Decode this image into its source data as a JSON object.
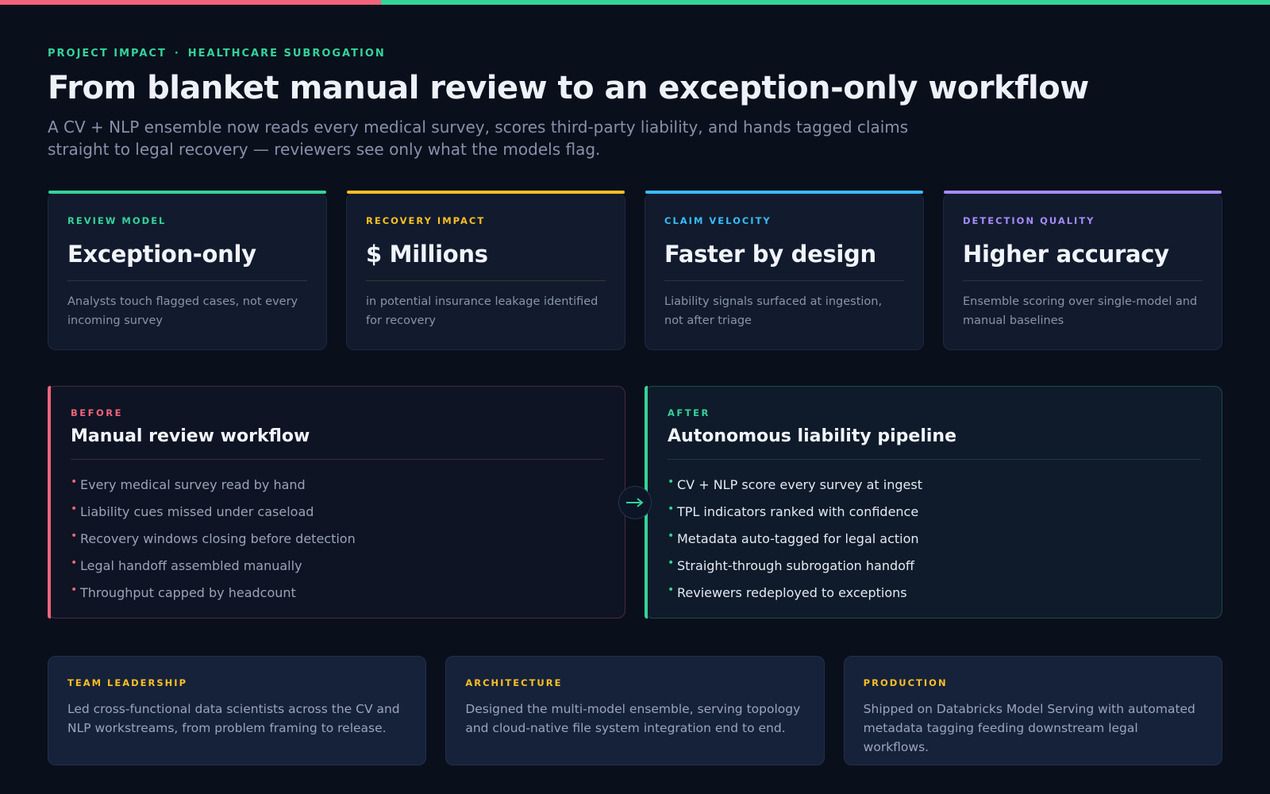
{
  "colors": {
    "background": "#0a0f1c",
    "green": "#34d399",
    "pink": "#f0647c",
    "yellow": "#fbbf24",
    "blue": "#38bdf8",
    "purple": "#a78bfa"
  },
  "header": {
    "eyebrow_left": "PROJECT IMPACT",
    "eyebrow_sep": "·",
    "eyebrow_right": "HEALTHCARE SUBROGATION",
    "title": "From blanket manual review to an exception-only workflow",
    "subtitle": "A CV + NLP ensemble now reads every medical survey, scores third-party liability, and hands tagged claims straight to legal recovery — reviewers see only what the models flag."
  },
  "kpis": [
    {
      "label": "REVIEW MODEL",
      "value": "Exception-only",
      "desc": "Analysts touch flagged cases, not every incoming survey",
      "color": "#34d399"
    },
    {
      "label": "RECOVERY IMPACT",
      "value": "$ Millions",
      "desc": "in potential insurance leakage identified for recovery",
      "color": "#fbbf24"
    },
    {
      "label": "CLAIM VELOCITY",
      "value": "Faster by design",
      "desc": "Liability signals surfaced at ingestion, not after triage",
      "color": "#38bdf8"
    },
    {
      "label": "DETECTION QUALITY",
      "value": "Higher accuracy",
      "desc": "Ensemble scoring over single-model and manual baselines",
      "color": "#a78bfa"
    }
  ],
  "before": {
    "label": "BEFORE",
    "title": "Manual review workflow",
    "items": [
      "Every medical survey read by hand",
      "Liability cues missed under caseload",
      "Recovery windows closing before detection",
      "Legal handoff assembled manually",
      "Throughput capped by headcount"
    ]
  },
  "after": {
    "label": "AFTER",
    "title": "Autonomous liability pipeline",
    "items": [
      "CV + NLP score every survey at ingest",
      "TPL indicators ranked with confidence",
      "Metadata auto-tagged for legal action",
      "Straight-through subrogation handoff",
      "Reviewers redeployed to exceptions"
    ]
  },
  "transition_icon": "arrow-right-icon",
  "bottom_cards": [
    {
      "label": "TEAM LEADERSHIP",
      "text": "Led cross-functional data scientists across the CV and NLP workstreams, from problem framing to release."
    },
    {
      "label": "ARCHITECTURE",
      "text": "Designed the multi-model ensemble, serving topology and cloud-native file system integration end to end."
    },
    {
      "label": "PRODUCTION",
      "text": "Shipped on Databricks Model Serving with automated metadata tagging feeding downstream legal workflows."
    }
  ]
}
